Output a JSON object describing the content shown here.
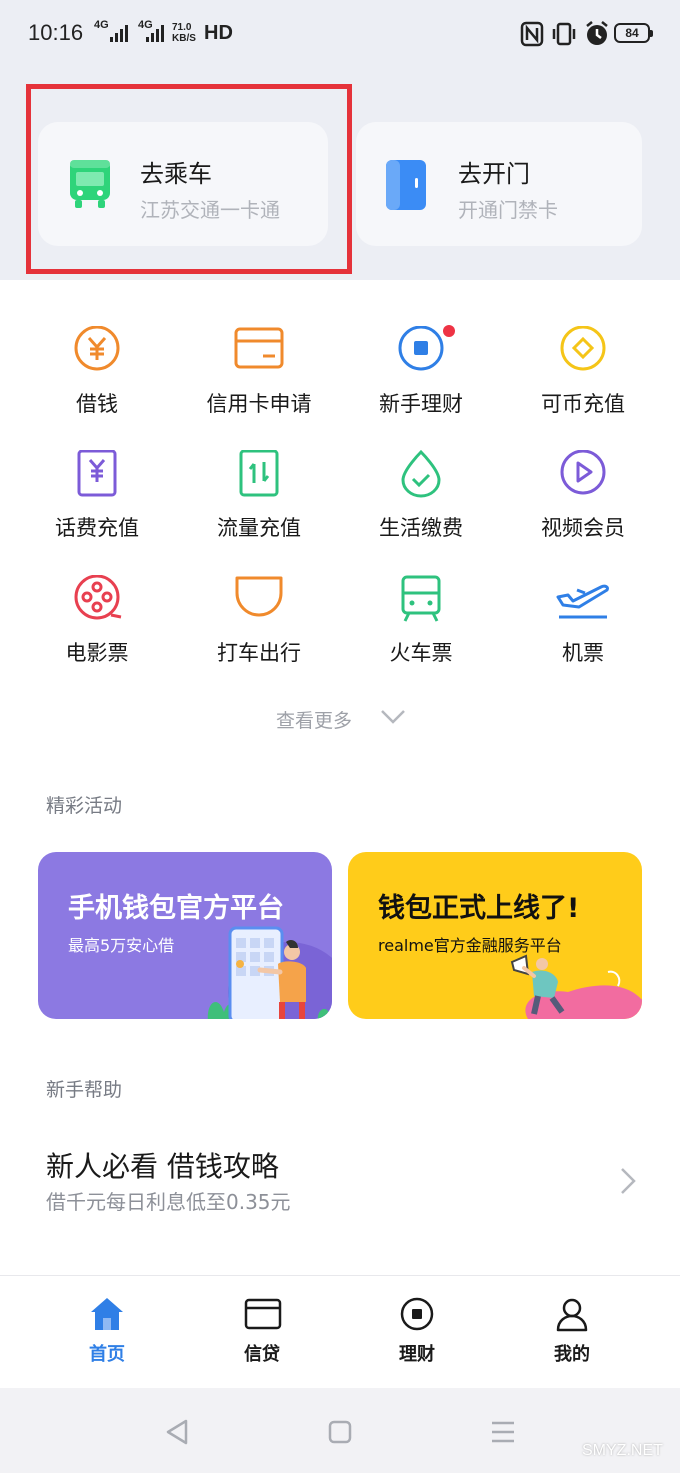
{
  "status_bar": {
    "time": "10:16",
    "net_speed_value": "71.0",
    "net_speed_unit": "KB/S",
    "signal_1": "4G",
    "signal_2": "4G",
    "hd": "HD",
    "battery": "84"
  },
  "quick_cards": [
    {
      "title": "去乘车",
      "subtitle": "江苏交通一卡通",
      "icon": "bus-icon",
      "color": "#2ed47a"
    },
    {
      "title": "去开门",
      "subtitle": "开通门禁卡",
      "icon": "door-icon",
      "color": "#3b8cf5"
    }
  ],
  "services": [
    {
      "label": "借钱",
      "icon": "yuan-coin-icon",
      "color": "#f08a2c"
    },
    {
      "label": "信用卡申请",
      "icon": "credit-card-icon",
      "color": "#f08a2c"
    },
    {
      "label": "新手理财",
      "icon": "finance-circle-icon",
      "color": "#2f7fe6",
      "badge": true
    },
    {
      "label": "可币充值",
      "icon": "coin-diamond-icon",
      "color": "#f5c518"
    },
    {
      "label": "话费充值",
      "icon": "phone-bill-icon",
      "color": "#7c5bd8"
    },
    {
      "label": "流量充值",
      "icon": "data-transfer-icon",
      "color": "#2ec27e"
    },
    {
      "label": "生活缴费",
      "icon": "water-drop-icon",
      "color": "#2ec27e"
    },
    {
      "label": "视频会员",
      "icon": "play-circle-icon",
      "color": "#7c5bd8"
    },
    {
      "label": "电影票",
      "icon": "film-reel-icon",
      "color": "#e84050"
    },
    {
      "label": "打车出行",
      "icon": "taxi-icon",
      "color": "#f08a2c"
    },
    {
      "label": "火车票",
      "icon": "train-icon",
      "color": "#2ec27e"
    },
    {
      "label": "机票",
      "icon": "airplane-icon",
      "color": "#2f7fe6"
    }
  ],
  "more_label": "查看更多",
  "activities": {
    "title": "精彩活动",
    "banners": [
      {
        "title": "手机钱包官方平台",
        "subtitle": "最高5万安心借",
        "color": "#8c79e2"
      },
      {
        "title": "钱包正式上线了!",
        "subtitle": "realme官方金融服务平台",
        "color": "#ffcc1a"
      }
    ]
  },
  "help": {
    "title": "新手帮助",
    "item_title": "新人必看 借钱攻略",
    "item_subtitle": "借千元每日利息低至0.35元"
  },
  "tabs": [
    {
      "label": "首页",
      "icon": "home-icon",
      "active": true
    },
    {
      "label": "信贷",
      "icon": "card-icon",
      "active": false
    },
    {
      "label": "理财",
      "icon": "finance-icon",
      "active": false
    },
    {
      "label": "我的",
      "icon": "person-icon",
      "active": false
    }
  ],
  "watermark": "SMYZ.NET",
  "accent_color": "#2f7fe6",
  "highlight_color": "#e5323a"
}
